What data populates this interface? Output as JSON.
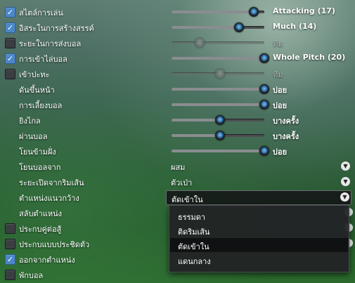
{
  "rows": [
    {
      "label": "สไตล์การเล่น",
      "checked": true,
      "level": 0.89,
      "value": "Attacking (17)"
    },
    {
      "label": "อิสระในการสร้างสรรค์",
      "checked": true,
      "level": 0.73,
      "value": "Much (14)"
    },
    {
      "label": "ระยะในการส่งบอล",
      "checked": false,
      "level": 0.3,
      "value": "ทีม",
      "disabled": true
    },
    {
      "label": "การเข้าไล่บอล",
      "checked": true,
      "level": 1.0,
      "value": "Whole Pitch (20)"
    },
    {
      "label": "เข้าปะทะ",
      "checked": false,
      "level": 0.52,
      "value": "ทีม",
      "disabled": true
    },
    {
      "label": "ดันขึ้นหน้า",
      "level": 1.0,
      "value": "บ่อย"
    },
    {
      "label": "การเลี้ยงบอล",
      "level": 1.0,
      "value": "บ่อย"
    },
    {
      "label": "ยิงไกล",
      "level": 0.52,
      "value": "บางครั้ง"
    },
    {
      "label": "ผ่านบอล",
      "level": 0.52,
      "value": "บางครั้ง"
    },
    {
      "label": "โยนข้ามฝั่ง",
      "level": 1.0,
      "value": "บ่อย"
    }
  ],
  "selects": [
    {
      "label": "โยนบอลจาก",
      "value": "ผสม"
    },
    {
      "label": "ระยะเปิดจากริมเส้น",
      "value": "ตัวเป่า"
    },
    {
      "label": "ตำแหน่งแนวกว้าง",
      "value": "ตัดเข้าใน"
    }
  ],
  "bottom": [
    {
      "label": "สลับตำแหน่ง"
    },
    {
      "label": "ประกบคู่ต่อสู้",
      "checked": false
    },
    {
      "label": "ประกบแบบประชิดตัว",
      "checked": false
    },
    {
      "label": "ออกจากตำแหน่ง",
      "checked": true
    },
    {
      "label": "พักบอล",
      "checked": false
    }
  ],
  "dropdown": {
    "options": [
      "ธรรมดา",
      "ติดริมเส้น",
      "ตัดเข้าใน",
      "แดนกลาง"
    ],
    "selected_index": 2
  }
}
